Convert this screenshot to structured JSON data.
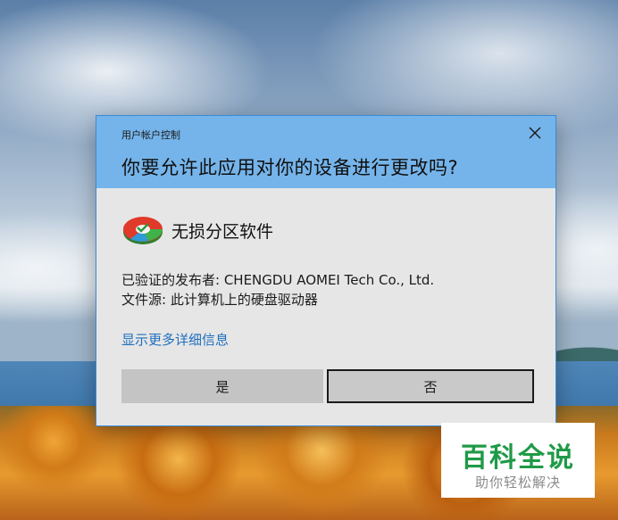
{
  "dialog": {
    "title": "用户帐户控制",
    "question": "你要允许此应用对你的设备进行更改吗?",
    "app_name": "无损分区软件",
    "publisher": "已验证的发布者: CHENGDU AOMEI Tech Co., Ltd.",
    "source": "文件源: 此计算机上的硬盘驱动器",
    "details_link": "显示更多详细信息",
    "yes_label": "是",
    "no_label": "否",
    "close_icon": "close-icon",
    "app_icon": "partition-disk-icon"
  },
  "watermark": {
    "title": "百科全说",
    "subtitle": "助你轻松解决"
  },
  "colors": {
    "header_blue": "#75b4ea",
    "dialog_bg": "#e6e6e6",
    "link_blue": "#1f6fbf",
    "watermark_green": "#1f9a47"
  }
}
